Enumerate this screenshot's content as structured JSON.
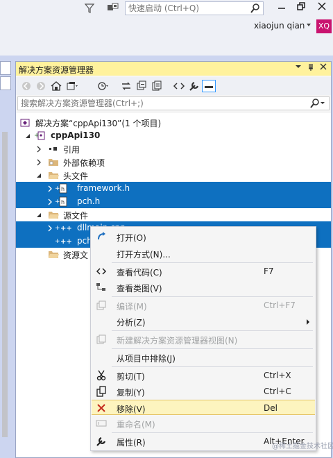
{
  "titlebar": {
    "quick_launch_placeholder": "快速启动 (Ctrl+Q)",
    "user_name": "xiaojun qian",
    "avatar_initials": "XQ",
    "avatar_color": "#c9136f"
  },
  "panel": {
    "title": "解决方案资源管理器",
    "search_placeholder": "搜索解决方案资源管理器(Ctrl+;)"
  },
  "tree": {
    "solution": "解决方案“cppApi130”(1 个项目)",
    "project": "cppApi130",
    "references": "引用",
    "external_deps": "外部依赖项",
    "headers_folder": "头文件",
    "header_files": [
      "framework.h",
      "pch.h"
    ],
    "sources_folder": "源文件",
    "source_files": [
      "dllmain.cpp",
      "pch"
    ],
    "resources_folder": "资源文"
  },
  "context_menu": {
    "items": [
      {
        "label": "打开(O)",
        "shortcut": "",
        "icon": "open-icon",
        "enabled": true
      },
      {
        "label": "打开方式(N)...",
        "shortcut": "",
        "icon": "",
        "enabled": true
      },
      {
        "label": "查看代码(C)",
        "shortcut": "F7",
        "icon": "code-icon",
        "enabled": true
      },
      {
        "label": "查看类图(V)",
        "shortcut": "",
        "icon": "class-diagram-icon",
        "enabled": true
      },
      {
        "label": "编译(M)",
        "shortcut": "Ctrl+F7",
        "icon": "compile-icon",
        "enabled": false
      },
      {
        "label": "分析(Z)",
        "shortcut": "",
        "icon": "",
        "enabled": true
      },
      {
        "label": "新建解决方案资源管理器视图(N)",
        "shortcut": "",
        "icon": "new-view-icon",
        "enabled": false
      },
      {
        "label": "从项目中排除(J)",
        "shortcut": "",
        "icon": "",
        "enabled": true
      },
      {
        "label": "剪切(T)",
        "shortcut": "Ctrl+X",
        "icon": "cut-icon",
        "enabled": true
      },
      {
        "label": "复制(Y)",
        "shortcut": "Ctrl+C",
        "icon": "copy-icon",
        "enabled": true
      },
      {
        "label": "移除(V)",
        "shortcut": "Del",
        "icon": "remove-icon",
        "enabled": true
      },
      {
        "label": "重命名(M)",
        "shortcut": "",
        "icon": "rename-icon",
        "enabled": false
      },
      {
        "label": "属性(R)",
        "shortcut": "Alt+Enter",
        "icon": "wrench-icon",
        "enabled": true
      }
    ]
  },
  "watermark": "@稀土掘金技术社区",
  "colors": {
    "selection": "#0e70c0",
    "panel_header": "#fff29d",
    "menu_hover": "#fdf4bf"
  }
}
